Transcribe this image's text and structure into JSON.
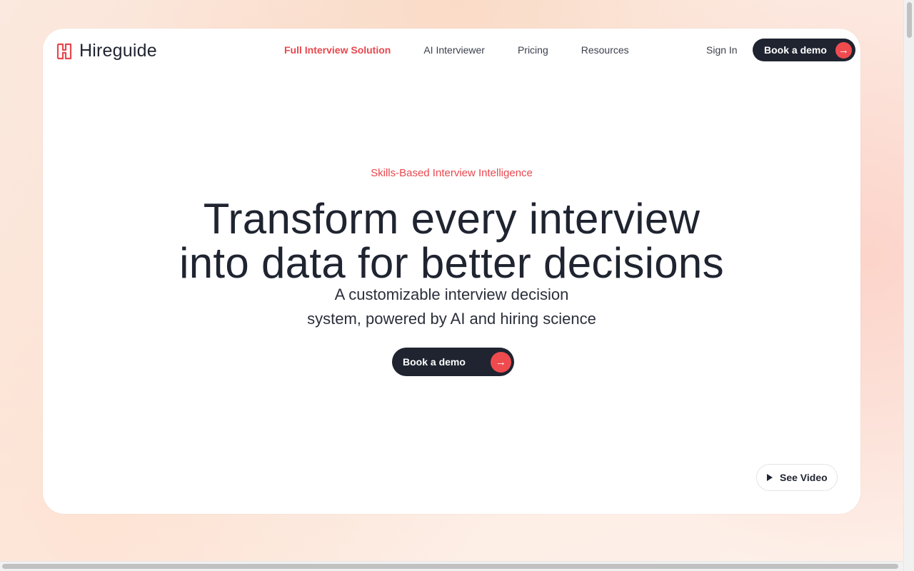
{
  "brand": {
    "name": "Hireguide",
    "accent": "#e8484e",
    "dark": "#1f2430"
  },
  "nav": {
    "items": [
      {
        "label": "Full Interview Solution",
        "active": true
      },
      {
        "label": "AI Interviewer",
        "active": false
      },
      {
        "label": "Pricing",
        "active": false
      },
      {
        "label": "Resources",
        "active": false
      }
    ],
    "sign_in": "Sign In",
    "cta": "Book a demo"
  },
  "hero": {
    "eyebrow": "Skills-Based Interview Intelligence",
    "headline_line1": "Transform every interview",
    "headline_line2": "into data for better decisions",
    "sub_line1": "A customizable interview decision",
    "sub_line2": "system, powered by AI and hiring science",
    "cta": "Book a demo",
    "video": "See Video"
  },
  "icons": {
    "arrow": "arrow-right-icon",
    "play": "play-icon",
    "logo": "hireguide-logo-icon"
  }
}
